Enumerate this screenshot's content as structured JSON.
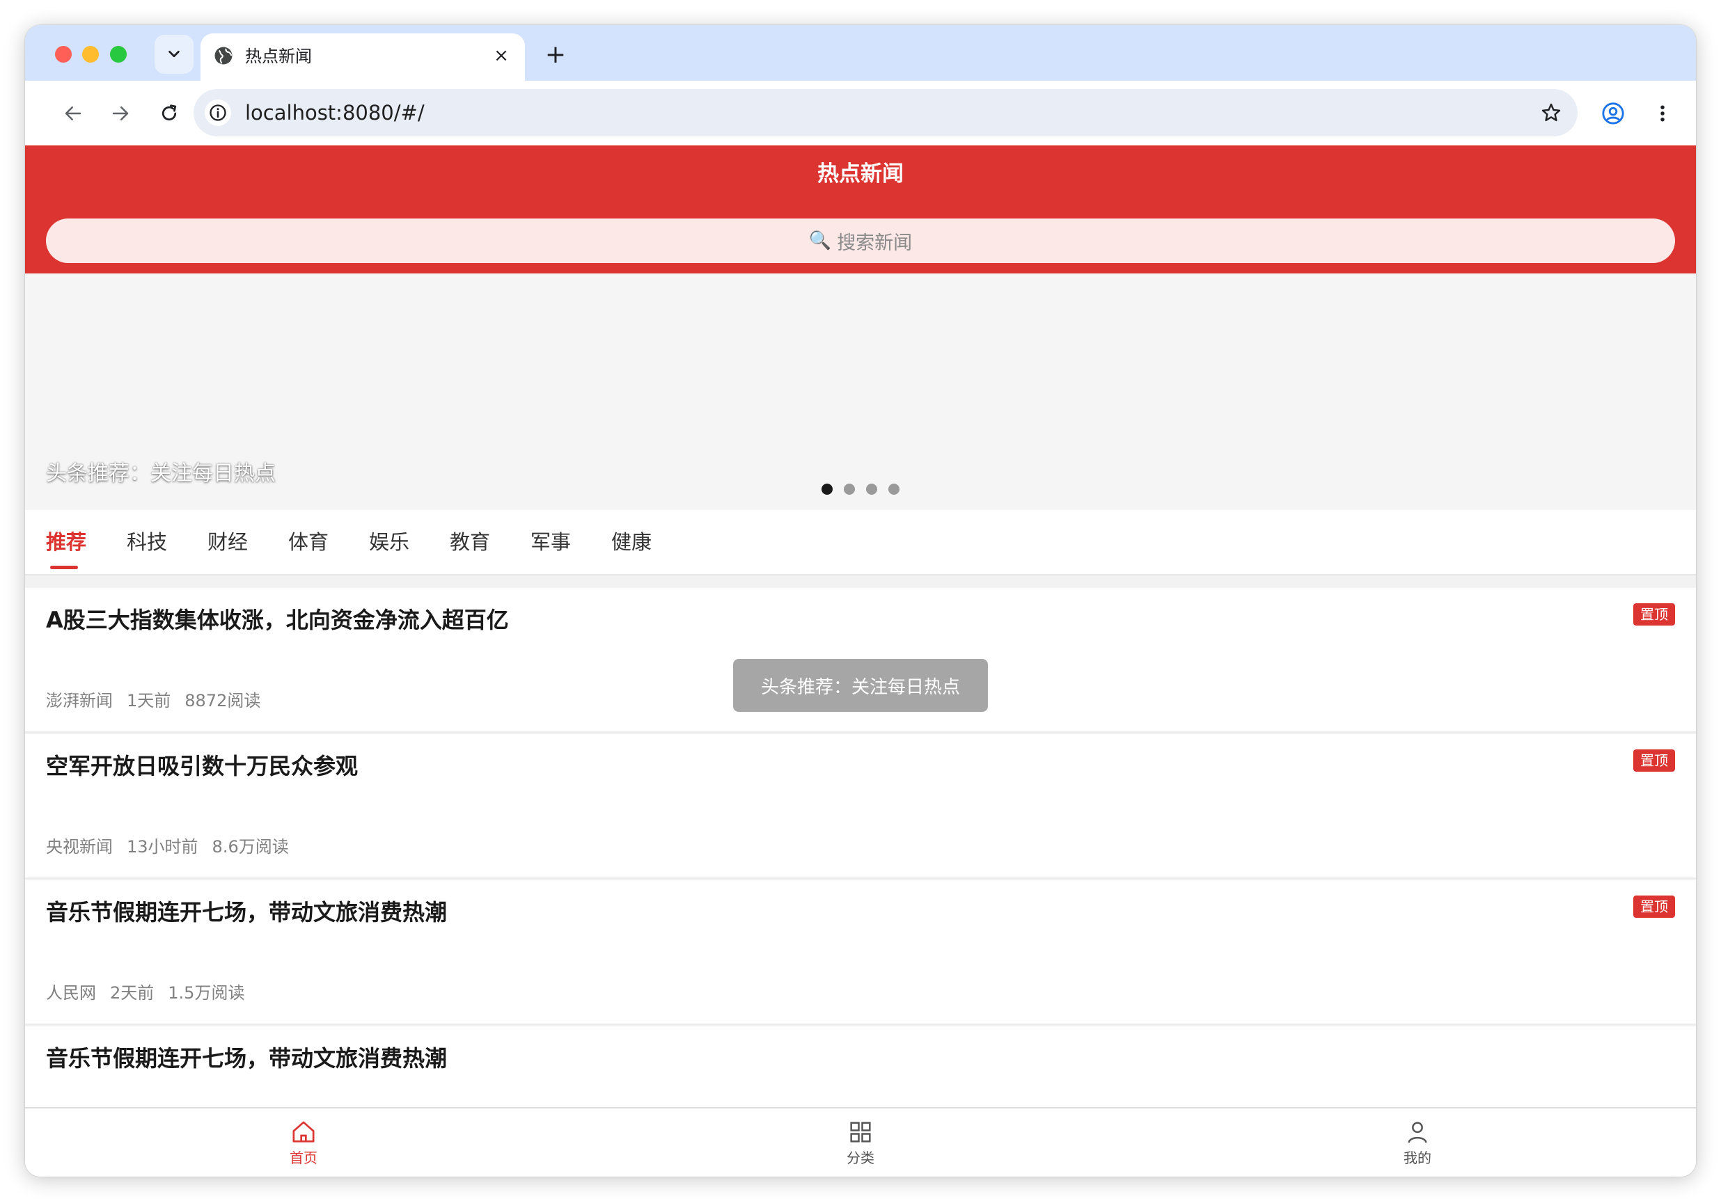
{
  "browser": {
    "tab_title": "热点新闻",
    "url": "localhost:8080/#/",
    "close_glyph": "×",
    "newtab_glyph": "+"
  },
  "app": {
    "header_title": "热点新闻",
    "search_icon": "🔍",
    "search_placeholder": "搜索新闻",
    "banner_caption": "头条推荐：关注每日热点",
    "banner_dots": 4,
    "banner_active_dot": 0,
    "categories": [
      "推荐",
      "科技",
      "财经",
      "体育",
      "娱乐",
      "教育",
      "军事",
      "健康"
    ],
    "active_category": "推荐",
    "news": [
      {
        "title": "A股三大指数集体收涨，北向资金净流入超百亿",
        "pinned": true,
        "pin_label": "置顶",
        "source": "澎湃新闻",
        "time": "1天前",
        "reads": "8872阅读"
      },
      {
        "title": "空军开放日吸引数十万民众参观",
        "pinned": true,
        "pin_label": "置顶",
        "source": "央视新闻",
        "time": "13小时前",
        "reads": "8.6万阅读"
      },
      {
        "title": "音乐节假期连开七场，带动文旅消费热潮",
        "pinned": true,
        "pin_label": "置顶",
        "source": "人民网",
        "time": "2天前",
        "reads": "1.5万阅读"
      },
      {
        "title": "音乐节假期连开七场，带动文旅消费热潮",
        "pinned": false,
        "pin_label": "",
        "source": "",
        "time": "",
        "reads": ""
      }
    ],
    "toast": "头条推荐：关注每日热点",
    "tabbar": [
      {
        "label": "首页",
        "icon": "home-icon",
        "active": true
      },
      {
        "label": "分类",
        "icon": "grid-icon",
        "active": false
      },
      {
        "label": "我的",
        "icon": "user-icon",
        "active": false
      }
    ]
  },
  "colors": {
    "brand_red": "#dc3531",
    "search_bg": "#fde8e8",
    "tabstrip_bg": "#d3e3fd"
  }
}
